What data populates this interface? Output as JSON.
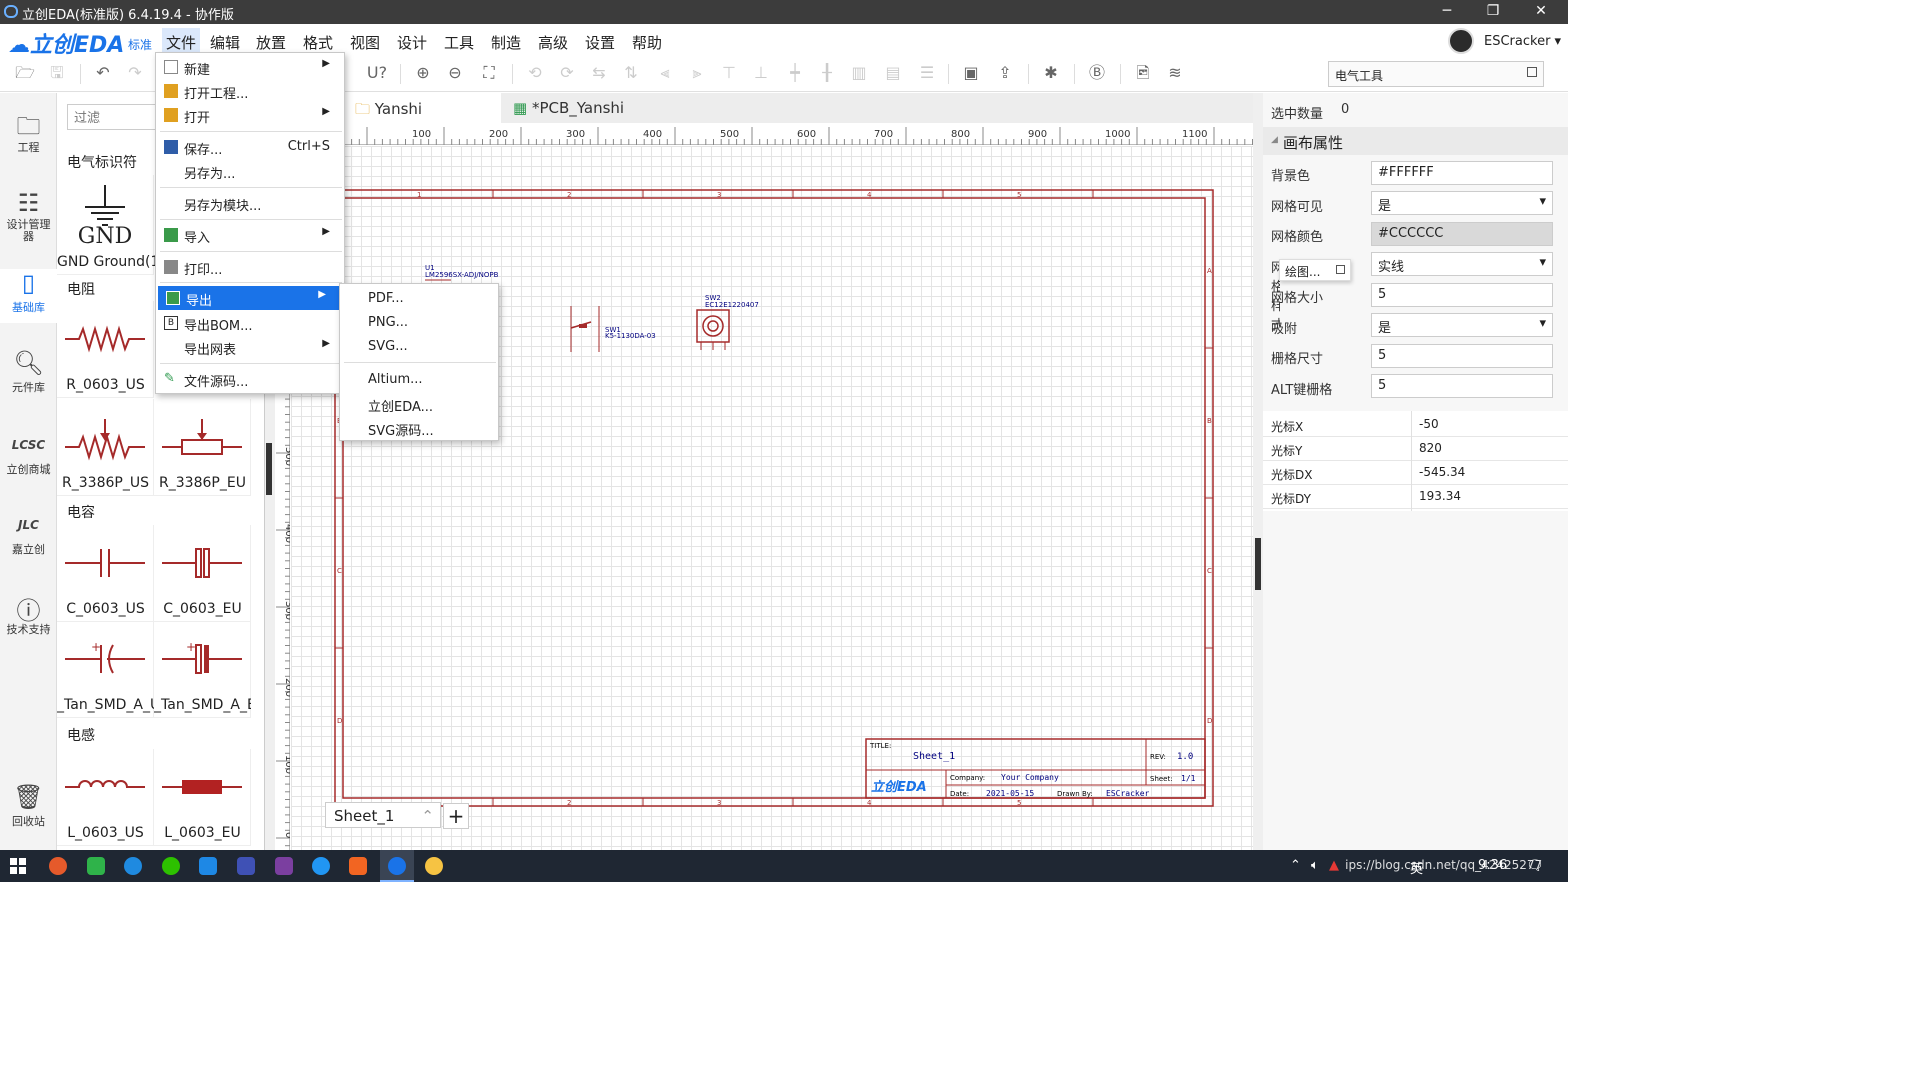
{
  "window": {
    "title": "立创EDA(标准版) 6.4.19.4 - 协作版"
  },
  "brand": {
    "name": "立创EDA",
    "edition": "标准"
  },
  "menubar": {
    "items": [
      "文件",
      "编辑",
      "放置",
      "格式",
      "视图",
      "设计",
      "工具",
      "制造",
      "高级",
      "设置",
      "帮助"
    ]
  },
  "user": {
    "name": "ESCracker ▾"
  },
  "elec_tool": {
    "title": "电气工具"
  },
  "leftnav": {
    "items": [
      {
        "label": "工程",
        "icon": "folder-icon"
      },
      {
        "label": "设计管理器",
        "icon": "list-icon"
      },
      {
        "label": "基础库",
        "icon": "chip-icon"
      },
      {
        "label": "元件库",
        "icon": "search-icon"
      },
      {
        "label": "立创商城",
        "icon": "lcsc-icon"
      },
      {
        "label": "嘉立创",
        "icon": "jlc-icon"
      },
      {
        "label": "技术支持",
        "icon": "help-icon"
      },
      {
        "label": "回收站",
        "icon": "trash-icon"
      }
    ]
  },
  "library": {
    "filter_placeholder": "过滤",
    "sections": {
      "electrical": "电气标识符",
      "resistor": "电阻",
      "capacitor": "电容",
      "inductor": "电感"
    },
    "parts": {
      "gnd": "GND Ground(1)",
      "r0603": "R_0603_US",
      "r3386us": "R_3386P_US",
      "r3386eu": "R_3386P_EU",
      "c0603us": "C_0603_US",
      "c0603eu": "C_0603_EU",
      "tanA": "_Tan_SMD_A_U",
      "tanE": "_Tan_SMD_A_E",
      "l0603us": "L_0603_US",
      "l0603eu": "L_0603_EU"
    }
  },
  "tabs": [
    {
      "label": "Yanshi",
      "active": true
    },
    {
      "label": "*PCB_Yanshi",
      "active": false
    }
  ],
  "ruler": {
    "top": [
      "100",
      "200",
      "300",
      "400",
      "500",
      "600",
      "700",
      "800",
      "900",
      "1000",
      "1100"
    ],
    "left": [
      "500",
      "400",
      "300",
      "200",
      "100",
      "0"
    ]
  },
  "schematic": {
    "u1_ref": "U1",
    "u1_part": "LM2596SX-ADJ/NOPB",
    "sw1_ref": "SW1",
    "sw1_part": "K5-1130DA-03",
    "sw2_ref": "SW2",
    "sw2_part": "EC12E1220407",
    "title_label": "TITLE:",
    "title_value": "Sheet_1",
    "rev_label": "REV:",
    "rev_value": "1.0",
    "company_label": "Company:",
    "company_value": "Your Company",
    "sheet_label": "Sheet:",
    "sheet_value": "1/1",
    "date_label": "Date:",
    "date_value": "2021-05-15",
    "drawn_label": "Drawn By:",
    "drawn_value": "ESCracker",
    "logo_text": "立创EDA",
    "frame_cols": [
      "1",
      "2",
      "3",
      "4",
      "5"
    ],
    "frame_rows": [
      "A",
      "B",
      "C",
      "D"
    ]
  },
  "sheet_tab": {
    "label": "Sheet_1",
    "add": "+"
  },
  "file_menu": {
    "items": [
      {
        "label": "新建",
        "submenu": true
      },
      {
        "label": "打开工程..."
      },
      {
        "label": "打开",
        "submenu": true
      },
      {
        "label": "保存...",
        "shortcut": "Ctrl+S"
      },
      {
        "label": "另存为..."
      },
      {
        "label": "另存为模块..."
      },
      {
        "label": "导入",
        "submenu": true
      },
      {
        "label": "打印..."
      },
      {
        "label": "导出",
        "submenu": true,
        "highlighted": true
      },
      {
        "label": "导出BOM..."
      },
      {
        "label": "导出网表",
        "submenu": true
      },
      {
        "label": "文件源码..."
      }
    ]
  },
  "export_menu": {
    "items": [
      "PDF...",
      "PNG...",
      "SVG...",
      "Altium...",
      "立创EDA...",
      "SVG源码..."
    ]
  },
  "right_panel": {
    "selected_label": "选中数量",
    "selected_value": "0",
    "section_title": "画布属性",
    "popup_label": "绘图...",
    "props": [
      {
        "label": "背景色",
        "value": "#FFFFFF",
        "type": "text"
      },
      {
        "label": "网格可见",
        "value": "是",
        "type": "select"
      },
      {
        "label": "网格颜色",
        "value": "#CCCCCC",
        "type": "color"
      },
      {
        "label": "网格样式",
        "value": "实线",
        "type": "select"
      },
      {
        "label": "网格大小",
        "value": "5",
        "type": "text"
      },
      {
        "label": "吸附",
        "value": "是",
        "type": "select"
      },
      {
        "label": "栅格尺寸",
        "value": "5",
        "type": "text"
      },
      {
        "label": "ALT键栅格",
        "value": "5",
        "type": "text"
      }
    ],
    "cursor": [
      {
        "label": "光标X",
        "value": "-50"
      },
      {
        "label": "光标Y",
        "value": "820"
      },
      {
        "label": "光标DX",
        "value": "-545.34"
      },
      {
        "label": "光标DY",
        "value": "193.34"
      }
    ]
  },
  "taskbar": {
    "tray_text": "ips://blog.csdn.net/qq_42425277",
    "ime": "英",
    "time": "9:36"
  },
  "colors": {
    "accent": "#1a73e8",
    "schematic_red": "#a52a2a",
    "menu_highlight": "#1a73e8"
  }
}
